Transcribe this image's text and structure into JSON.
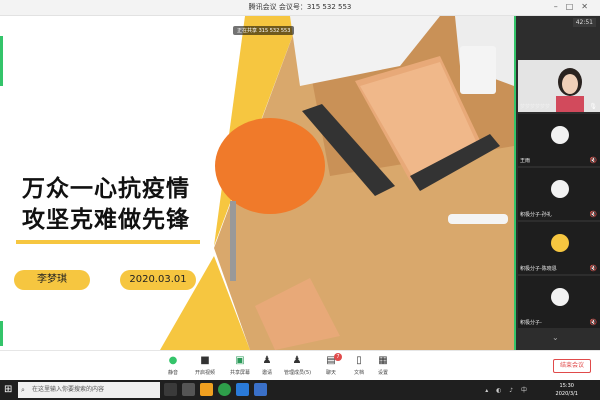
{
  "window": {
    "title": "腾讯会议  会议号：315 532 553"
  },
  "stage": {
    "share_tag": "正在共享 315 532 553",
    "heading_line1": "万众一心抗疫情",
    "heading_line2": "攻坚克难做先锋",
    "name_pill": "李梦琪",
    "date_pill": "2020.03.01"
  },
  "participants": {
    "timer": "42:51",
    "tiles": [
      {
        "label": "梦梦梦梦梦梦",
        "kind": "video"
      },
      {
        "label": "王雨",
        "kind": "avatar"
      },
      {
        "label": "积极分子-孙礼",
        "kind": "avatar"
      },
      {
        "label": "积极分子-陈晓恩",
        "kind": "avatar"
      },
      {
        "label": "积极分子-",
        "kind": "avatar"
      }
    ]
  },
  "toolbar": {
    "items": [
      {
        "label": "静音",
        "icon": "mic-icon"
      },
      {
        "label": "开启视频",
        "icon": "camera-icon"
      },
      {
        "label": "共享屏幕",
        "icon": "screen-share-icon"
      },
      {
        "label": "邀请",
        "icon": "invite-icon"
      },
      {
        "label": "管理成员(5)",
        "icon": "members-icon"
      },
      {
        "label": "聊天",
        "icon": "chat-icon",
        "badge": "7"
      },
      {
        "label": "文档",
        "icon": "document-icon"
      },
      {
        "label": "设置",
        "icon": "settings-icon"
      }
    ],
    "end_label": "结束会议"
  },
  "taskbar": {
    "search_placeholder": "在这里输入你要搜索的内容",
    "time": "15:30",
    "date": "2020/3/1"
  },
  "colors": {
    "accent_green": "#34c46a",
    "slide_yellow": "#f6c640",
    "end_red": "#e04a4a"
  }
}
